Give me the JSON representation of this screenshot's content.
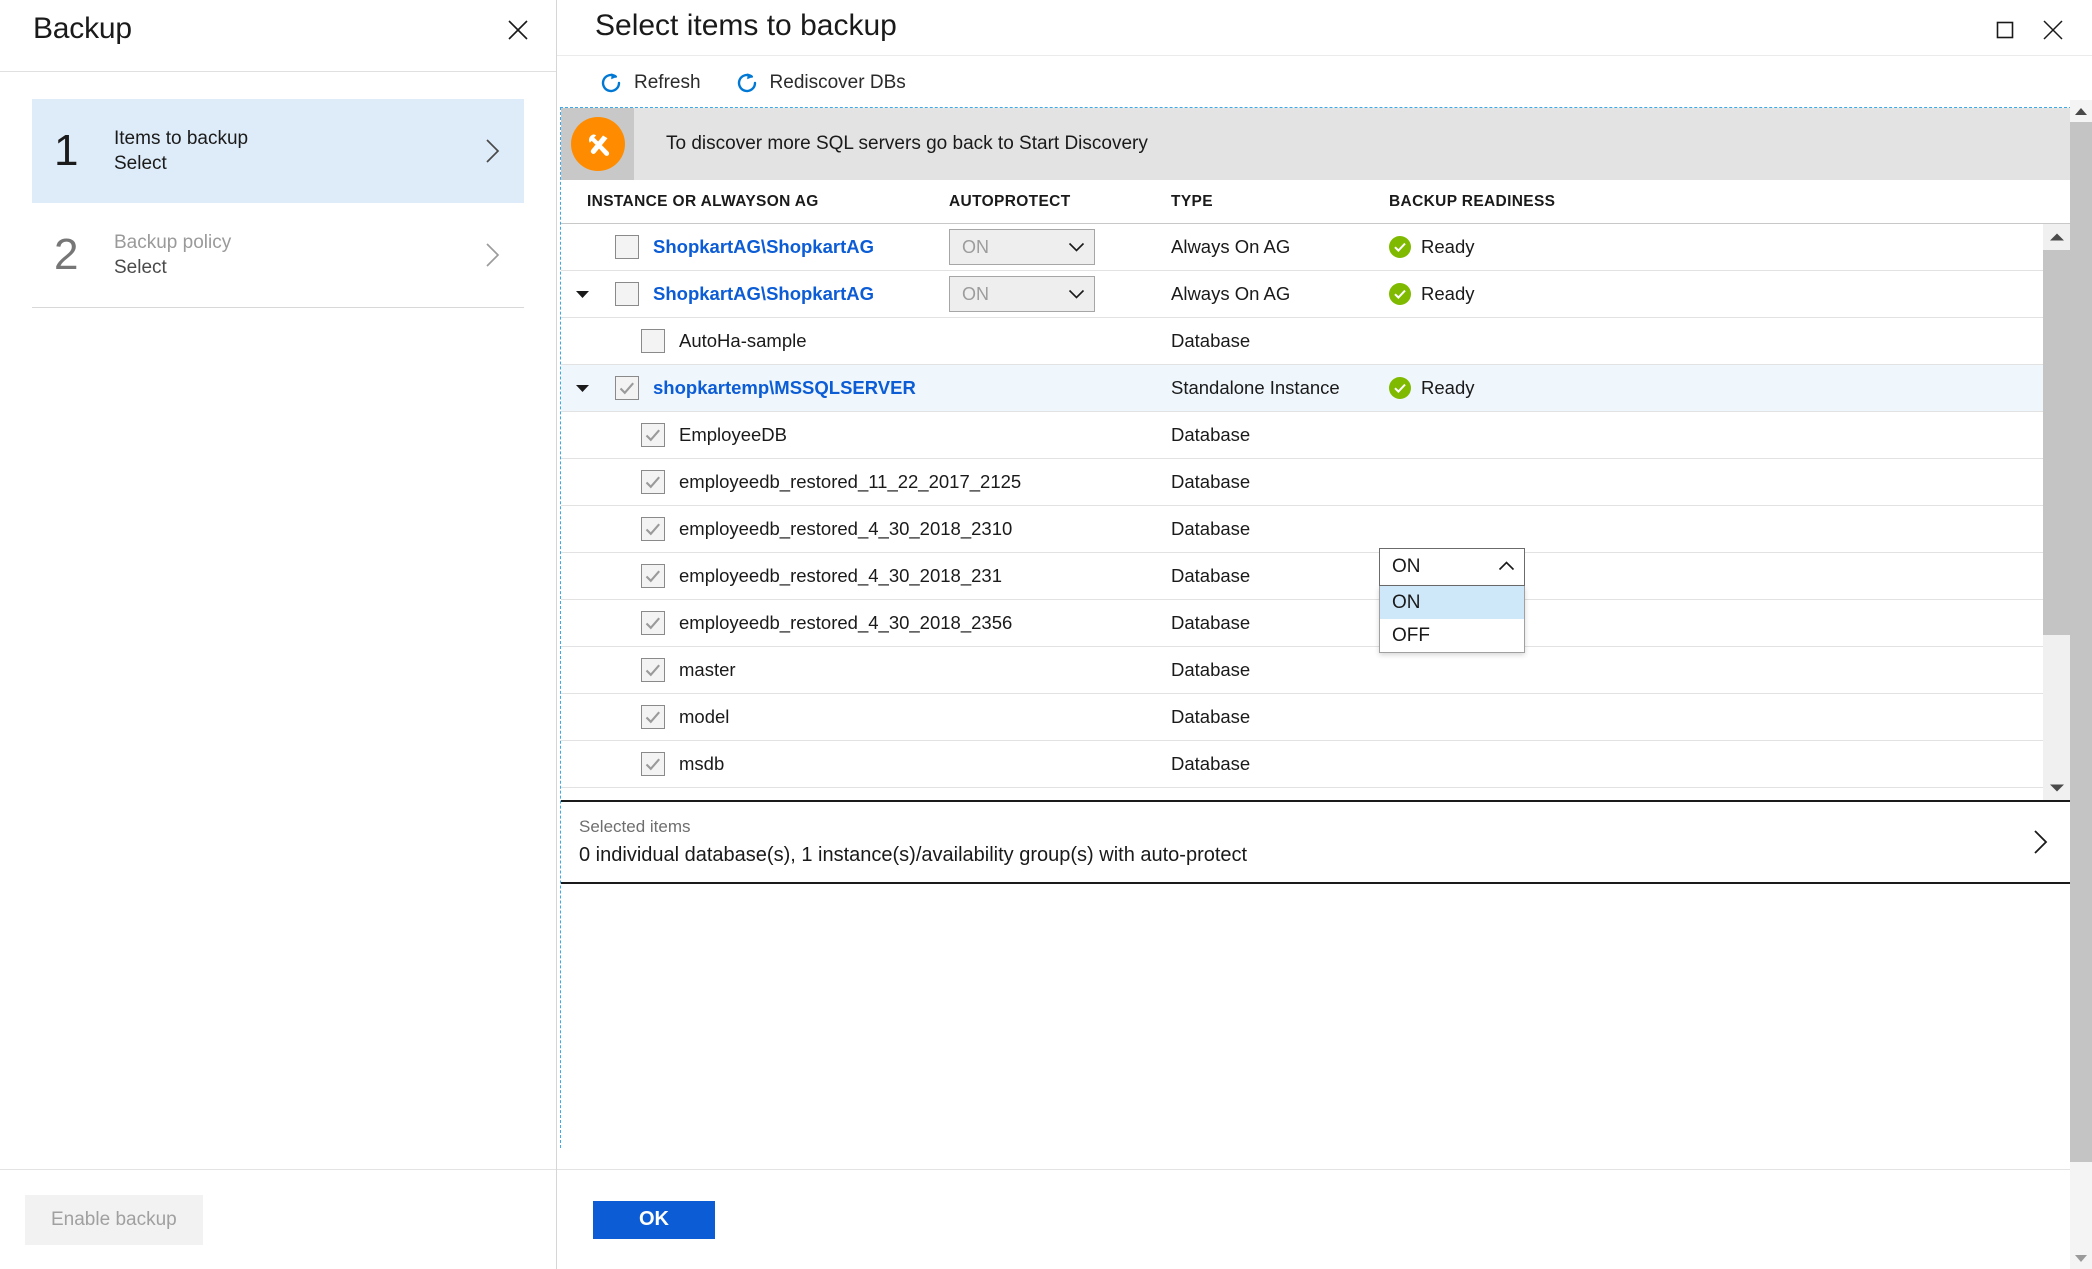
{
  "left_blade": {
    "title": "Backup",
    "close_icon": "close-icon",
    "steps": [
      {
        "number": "1",
        "title": "Items to backup",
        "subtitle": "Select",
        "state": "active"
      },
      {
        "number": "2",
        "title": "Backup policy",
        "subtitle": "Select",
        "state": "inactive"
      }
    ],
    "footer": {
      "enable_backup_label": "Enable backup"
    }
  },
  "right_blade": {
    "title": "Select items to backup",
    "window_controls": {
      "maximize": "maximize-icon",
      "close": "close-icon"
    },
    "command_bar": [
      {
        "label": "Refresh",
        "icon": "refresh-icon"
      },
      {
        "label": "Rediscover DBs",
        "icon": "refresh-icon"
      }
    ],
    "info_bar": {
      "icon": "tools-icon",
      "message": "To discover more SQL servers go back to Start Discovery"
    },
    "table": {
      "columns": [
        "INSTANCE OR ALWAYSON AG",
        "AUTOPROTECT",
        "TYPE",
        "BACKUP READINESS"
      ],
      "rows": [
        {
          "name": "ShopkartAG\\ShopkartAG",
          "level": "instance",
          "link": true,
          "expander": "none",
          "checked": false,
          "autoprotect": "ON",
          "autoprotect_state": "disabled",
          "type": "Always On AG",
          "readiness": "Ready",
          "readiness_state": "ok",
          "selected": false
        },
        {
          "name": "ShopkartAG\\ShopkartAG",
          "level": "instance",
          "link": true,
          "expander": "expanded",
          "checked": false,
          "autoprotect": "ON",
          "autoprotect_state": "disabled",
          "type": "Always On AG",
          "readiness": "Ready",
          "readiness_state": "ok",
          "selected": false
        },
        {
          "name": "AutoHa-sample",
          "level": "database",
          "link": false,
          "expander": "none",
          "checked": false,
          "autoprotect": "",
          "autoprotect_state": "none",
          "type": "Database",
          "readiness": "",
          "readiness_state": "none",
          "selected": false
        },
        {
          "name": "shopkartemp\\MSSQLSERVER",
          "level": "instance",
          "link": true,
          "expander": "expanded",
          "checked": true,
          "autoprotect": "ON",
          "autoprotect_state": "open",
          "type": "Standalone Instance",
          "readiness": "Ready",
          "readiness_state": "ok",
          "selected": true
        },
        {
          "name": "EmployeeDB",
          "level": "database",
          "link": false,
          "expander": "none",
          "checked": true,
          "autoprotect": "",
          "autoprotect_state": "none",
          "type": "Database",
          "readiness": "",
          "readiness_state": "none",
          "selected": false
        },
        {
          "name": "employeedb_restored_11_22_2017_2125",
          "level": "database",
          "link": false,
          "expander": "none",
          "checked": true,
          "autoprotect": "",
          "autoprotect_state": "none",
          "type": "Database",
          "readiness": "",
          "readiness_state": "none",
          "selected": false
        },
        {
          "name": "employeedb_restored_4_30_2018_2310",
          "level": "database",
          "link": false,
          "expander": "none",
          "checked": true,
          "autoprotect": "",
          "autoprotect_state": "none",
          "type": "Database",
          "readiness": "",
          "readiness_state": "none",
          "selected": false
        },
        {
          "name": "employeedb_restored_4_30_2018_231",
          "level": "database",
          "link": false,
          "expander": "none",
          "checked": true,
          "autoprotect": "",
          "autoprotect_state": "none",
          "type": "Database",
          "readiness": "",
          "readiness_state": "none",
          "selected": false
        },
        {
          "name": "employeedb_restored_4_30_2018_2356",
          "level": "database",
          "link": false,
          "expander": "none",
          "checked": true,
          "autoprotect": "",
          "autoprotect_state": "none",
          "type": "Database",
          "readiness": "",
          "readiness_state": "none",
          "selected": false
        },
        {
          "name": "master",
          "level": "database",
          "link": false,
          "expander": "none",
          "checked": true,
          "autoprotect": "",
          "autoprotect_state": "none",
          "type": "Database",
          "readiness": "",
          "readiness_state": "none",
          "selected": false
        },
        {
          "name": "model",
          "level": "database",
          "link": false,
          "expander": "none",
          "checked": true,
          "autoprotect": "",
          "autoprotect_state": "none",
          "type": "Database",
          "readiness": "",
          "readiness_state": "none",
          "selected": false
        },
        {
          "name": "msdb",
          "level": "database",
          "link": false,
          "expander": "none",
          "checked": true,
          "autoprotect": "",
          "autoprotect_state": "none",
          "type": "Database",
          "readiness": "",
          "readiness_state": "none",
          "selected": false
        }
      ]
    },
    "autoprotect_dropdown": {
      "value": "ON",
      "open": true,
      "options": [
        "ON",
        "OFF"
      ],
      "highlighted": "ON"
    },
    "selected_items": {
      "label": "Selected items",
      "value": "0 individual database(s), 1 instance(s)/availability group(s) with auto-protect",
      "chevron_icon": "chevron-right-icon"
    },
    "footer": {
      "ok_label": "OK"
    }
  },
  "colors": {
    "accent_blue": "#0b5cd5",
    "link_blue": "#0b5cd5",
    "refresh_blue": "#0078d4",
    "step_active_bg": "#deecf9",
    "row_selected_bg": "#eff6fc",
    "ready_green": "#7fba00",
    "info_orange": "#ff8c00",
    "info_bar_bg": "#e3e3e3",
    "dropdown_highlight": "#cfe8f9"
  }
}
